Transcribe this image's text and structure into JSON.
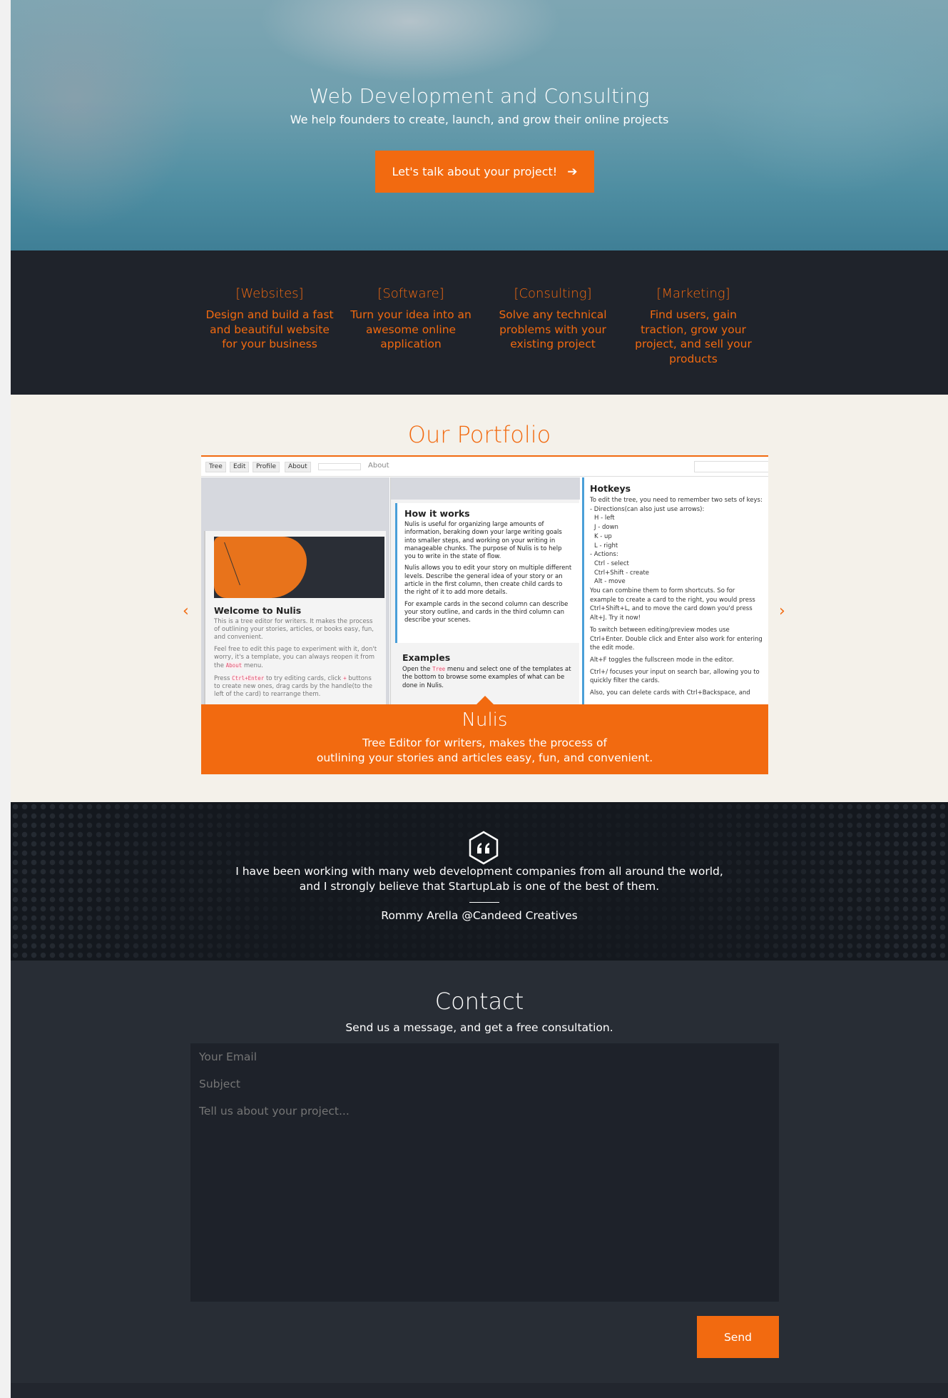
{
  "hero": {
    "title": "Web Development and Consulting",
    "subtitle": "We help founders to create, launch, and grow their online projects",
    "cta_label": "Let's talk about your project!",
    "cta_icon": "arrow-right-icon"
  },
  "services": [
    {
      "title": "[Websites]",
      "text": "Design and build a fast and beautiful website for your business"
    },
    {
      "title": "[Software]",
      "text": "Turn your idea into an awesome online application"
    },
    {
      "title": "[Consulting]",
      "text": "Solve any technical problems with your existing project"
    },
    {
      "title": "[Marketing]",
      "text": "Find users, gain traction, grow your project, and sell your products"
    }
  ],
  "portfolio": {
    "title": "Our Portfolio",
    "prev": "‹",
    "next": "›",
    "screenshot": {
      "toolbar": [
        "Tree",
        "Edit",
        "Profile",
        "About"
      ],
      "about_link": "About",
      "col1": {
        "heading": "Welcome to Nulis",
        "p1": "This is a tree editor for writers. It makes the process of outlining your stories, articles, or books easy, fun, and convenient.",
        "p2_a": "Feel free to edit this page to experiment with it, don't worry, it's a template, you can always reopen it from the",
        "p2_code": "About",
        "p2_b": "menu.",
        "p3_a": "Press",
        "p3_code": "Ctrl+Enter",
        "p3_b": "to try editing cards, click",
        "p3_code2": "+",
        "p3_c": "buttons to create new ones, drag cards by the handle(to the left of the card) to rearrange them."
      },
      "col2": {
        "heading": "How it works",
        "p1": "Nulis is useful for organizing large amounts of information, beraking down your large writing goals into smaller steps, and working on your writing in manageable chunks. The purpose of Nulis is to help you to write in the state of flow.",
        "p2": "Nulis allows you to edit your story on multiple different levels. Describe the general idea of your story or an article in the first column, then create child cards to the right of it to add more details.",
        "p3": "For example cards in the second column can describe your story outline, and cards in the third column can describe your scenes.",
        "heading2": "Examples",
        "e1_a": "Open the",
        "e1_code": "Tree",
        "e1_b": "menu and select one of the templates at the bottom to browse some examples of what can be done in Nulis."
      },
      "col3": {
        "heading": "Hotkeys",
        "lines": [
          "To edit the tree, you need to remember two sets of keys:",
          "- Directions(can also just use arrows):",
          "H - left",
          "J - down",
          "K - up",
          "L - right",
          "- Actions:",
          "Ctrl - select",
          "Ctrl+Shift - create",
          "Alt - move",
          "You can combine them to form shortcuts. So for example to create a card to the right, you would press Ctrl+Shift+L, and to move the card down you'd press Alt+J. Try it now!",
          "To switch between editing/preview modes use Ctrl+Enter. Double click and Enter also work for entering the edit mode.",
          "Alt+F toggles the fullscreen mode in the editor.",
          "Ctrl+/ focuses your input on search bar, allowing you to quickly filter the cards.",
          "Also, you can delete cards with Ctrl+Backspace, and"
        ]
      }
    },
    "caption_title": "Nulis",
    "caption_line1": "Tree Editor for writers, makes the process of",
    "caption_line2": "outlining your stories and articles easy, fun, and convenient."
  },
  "testimonial": {
    "icon": "quote-icon",
    "line1": "I have been working with many web development companies from all around the world,",
    "line2": "and I strongly believe that StartupLab is one of the best of them.",
    "author": "Rommy Arella @Candeed Creatives"
  },
  "contact": {
    "title": "Contact",
    "subtitle": "Send us a message, and get a free consultation.",
    "email_placeholder": "Your Email",
    "subject_placeholder": "Subject",
    "message_placeholder": "Tell us about your project...",
    "send_label": "Send"
  },
  "colors": {
    "accent": "#f26a10",
    "dark": "#1f232b",
    "contact_bg": "#282d35",
    "portfolio_bg": "#f4f1ea"
  }
}
